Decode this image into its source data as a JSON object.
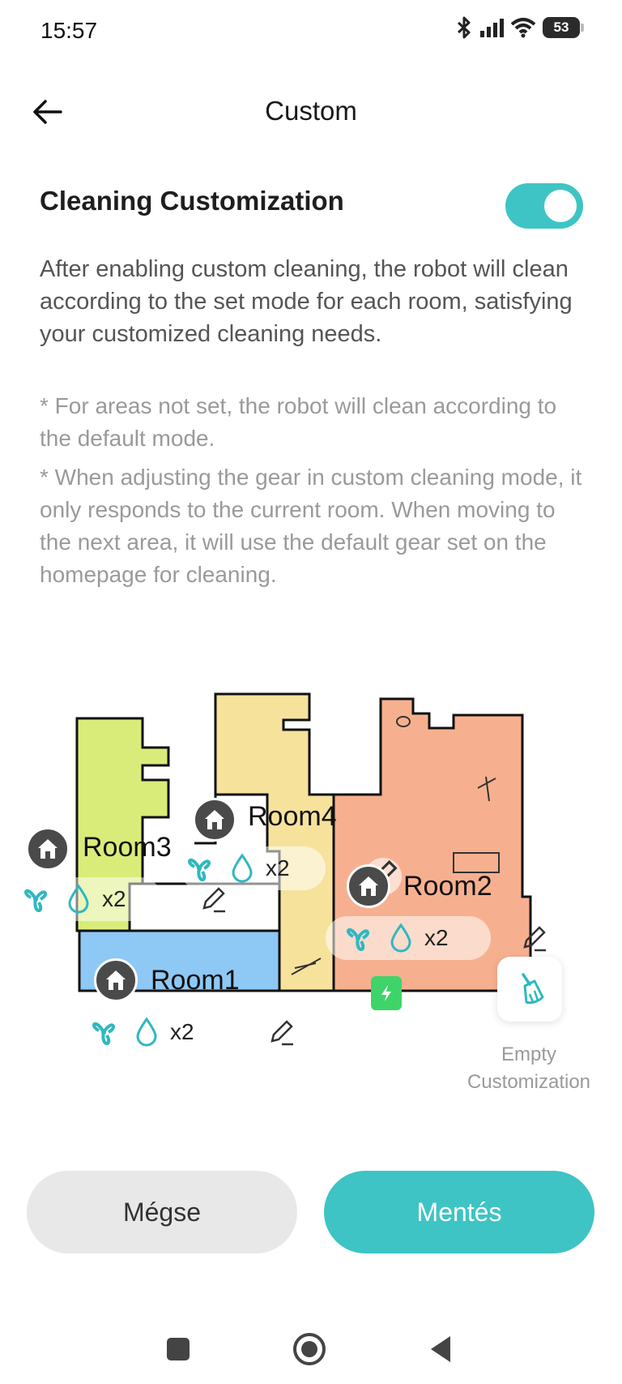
{
  "status_bar": {
    "time": "15:57",
    "battery": "53",
    "icons": [
      "bluetooth-icon",
      "signal-icon",
      "wifi-icon",
      "battery-icon"
    ]
  },
  "header": {
    "title": "Custom",
    "back_icon": "arrow-left-icon"
  },
  "customization": {
    "title": "Cleaning Customization",
    "enabled": true,
    "description": "After enabling custom cleaning, the robot will clean according to the set mode for each room, satisfying your customized cleaning needs.",
    "note_1": "* For areas not set, the robot will clean according to the default mode.",
    "note_2": "* When adjusting the gear in custom cleaning mode, it only responds to the current room. When moving to the next area, it will use the default gear set on the homepage for cleaning."
  },
  "map": {
    "rooms": [
      {
        "name": "Room1",
        "water_level": "x2",
        "color": "#8ec8f5"
      },
      {
        "name": "Room2",
        "water_level": "x2",
        "color": "#f7b08f"
      },
      {
        "name": "Room3",
        "water_level": "x2",
        "color": "#d9ec7a"
      },
      {
        "name": "Room4",
        "water_level": "x2",
        "color": "#f7e29c"
      }
    ],
    "empty_customization_label": "Empty Customization"
  },
  "buttons": {
    "cancel": "Mégse",
    "save": "Mentés"
  },
  "colors": {
    "accent": "#3ec4c4",
    "charger": "#3fd46a"
  },
  "navbar": [
    "recents-icon",
    "home-icon",
    "back-icon"
  ]
}
